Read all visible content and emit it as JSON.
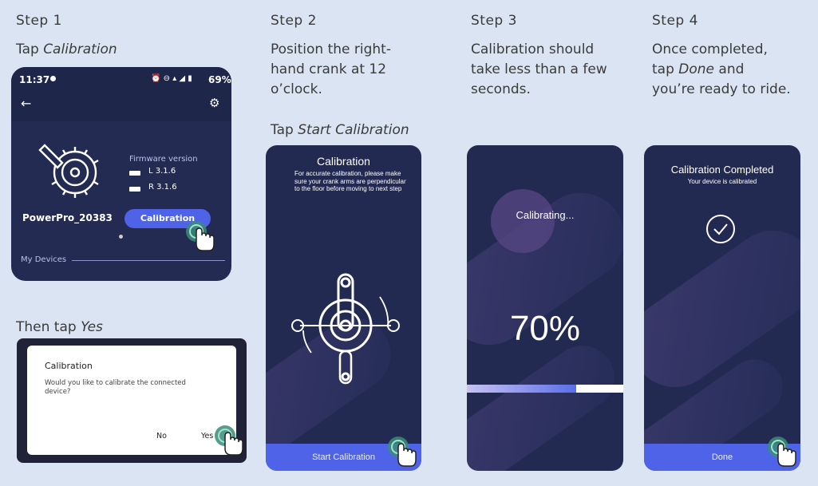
{
  "colors": {
    "background": "#dbe4f2",
    "phone": "#222a52",
    "accent": "#4f63e8"
  },
  "steps": [
    {
      "title": "Step 1",
      "instruction_prefix": "Tap ",
      "instruction_em": "Calibration"
    },
    {
      "title": "Step 2",
      "line1": "Position the right-",
      "line2": "hand crank at 12",
      "line3": "o’clock.",
      "tap_prefix": "Tap ",
      "tap_em": "Start Calibration"
    },
    {
      "title": "Step 3",
      "line1": "Calibration should",
      "line2": "take less than a few",
      "line3": "seconds."
    },
    {
      "title": "Step 4",
      "line1": "Once completed,",
      "line2_prefix": "tap ",
      "line2_em": "Done",
      "line2_suffix": " and",
      "line3": "you’re ready to ride."
    }
  ],
  "screen1": {
    "time": "11:37",
    "status_right": "69%",
    "firmware_label": "Firmware version",
    "left_version": "L 3.1.6",
    "right_version": "R 3.1.6",
    "device_name": "PowerPro_20383",
    "calibration_button": "Calibration",
    "my_devices": "My Devices",
    "icons": [
      "back-arrow-icon",
      "gear-icon",
      "crankset-icon",
      "battery-icon",
      "tap-hand-icon"
    ]
  },
  "then_tap": {
    "prefix": "Then tap ",
    "em": "Yes"
  },
  "dialog": {
    "title": "Calibration",
    "message": "Would you like to calibrate the connected device?",
    "no": "No",
    "yes": "Yes"
  },
  "screen2": {
    "title": "Calibration",
    "note": "For accurate calibration, please make sure your crank arms are perpendicular to the floor before moving to next step",
    "button": "Start Calibration"
  },
  "screen3": {
    "status": "Calibrating...",
    "percent": "70%",
    "progress": 0.7
  },
  "screen4": {
    "title": "Calibration Completed",
    "subtitle": "Your device is calibrated",
    "button": "Done"
  }
}
